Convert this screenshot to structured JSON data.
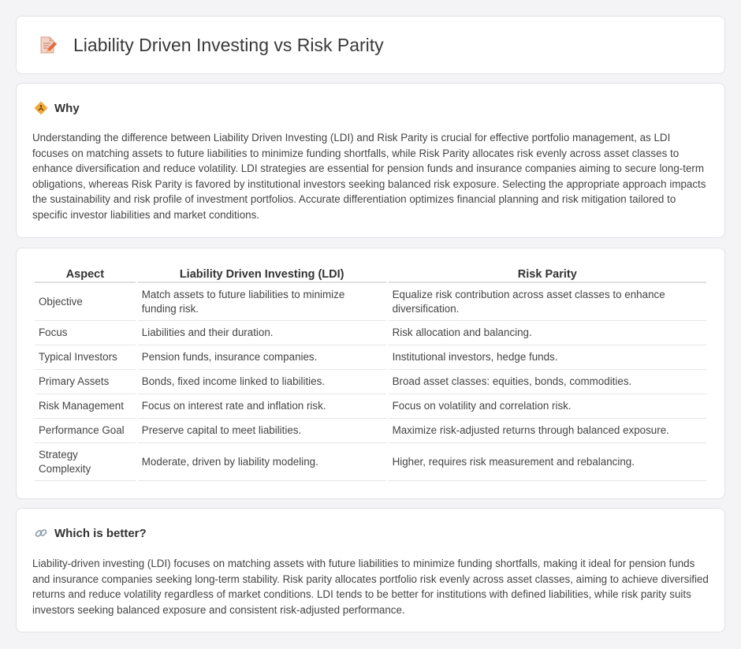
{
  "header": {
    "title": "Liability Driven Investing vs Risk Parity",
    "icon": "document-pencil-icon"
  },
  "why": {
    "title": "Why",
    "icon": "diamond-signal-icon",
    "text": "Understanding the difference between Liability Driven Investing (LDI) and Risk Parity is crucial for effective portfolio management, as LDI focuses on matching assets to future liabilities to minimize funding shortfalls, while Risk Parity allocates risk evenly across asset classes to enhance diversification and reduce volatility. LDI strategies are essential for pension funds and insurance companies aiming to secure long-term obligations, whereas Risk Parity is favored by institutional investors seeking balanced risk exposure. Selecting the appropriate approach impacts the sustainability and risk profile of investment portfolios. Accurate differentiation optimizes financial planning and risk mitigation tailored to specific investor liabilities and market conditions."
  },
  "table": {
    "headers": [
      "Aspect",
      "Liability Driven Investing (LDI)",
      "Risk Parity"
    ],
    "rows": [
      [
        "Objective",
        "Match assets to future liabilities to minimize funding risk.",
        "Equalize risk contribution across asset classes to enhance diversification."
      ],
      [
        "Focus",
        "Liabilities and their duration.",
        "Risk allocation and balancing."
      ],
      [
        "Typical Investors",
        "Pension funds, insurance companies.",
        "Institutional investors, hedge funds."
      ],
      [
        "Primary Assets",
        "Bonds, fixed income linked to liabilities.",
        "Broad asset classes: equities, bonds, commodities."
      ],
      [
        "Risk Management",
        "Focus on interest rate and inflation risk.",
        "Focus on volatility and correlation risk."
      ],
      [
        "Performance Goal",
        "Preserve capital to meet liabilities.",
        "Maximize risk-adjusted returns through balanced exposure."
      ],
      [
        "Strategy Complexity",
        "Moderate, driven by liability modeling.",
        "Higher, requires risk measurement and rebalancing."
      ]
    ]
  },
  "better": {
    "title": "Which is better?",
    "icon": "link-icon",
    "text": "Liability-driven investing (LDI) focuses on matching assets with future liabilities to minimize funding shortfalls, making it ideal for pension funds and insurance companies seeking long-term stability. Risk parity allocates portfolio risk evenly across asset classes, aiming to achieve diversified returns and reduce volatility regardless of market conditions. LDI tends to be better for institutions with defined liabilities, while risk parity suits investors seeking balanced exposure and consistent risk-adjusted performance."
  }
}
